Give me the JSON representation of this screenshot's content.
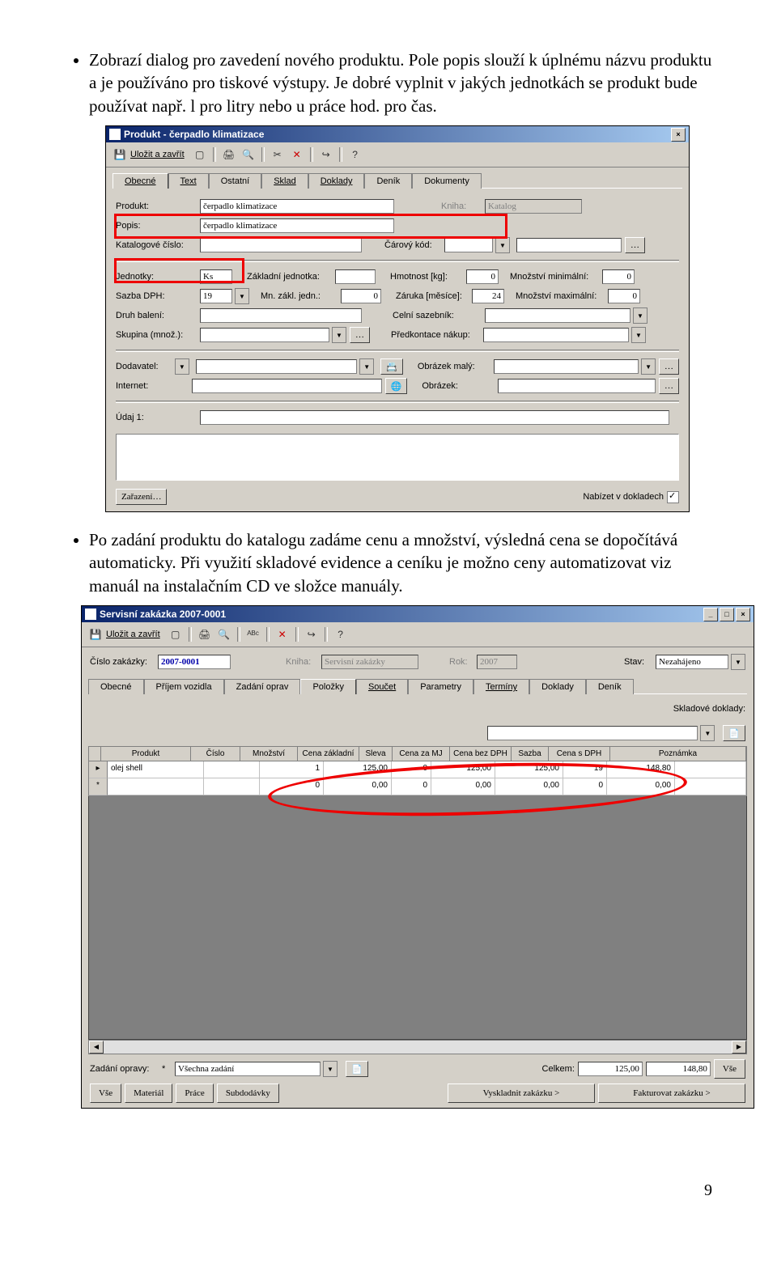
{
  "page_number": "9",
  "bullets": {
    "b1": "Zobrazí dialog pro zavedení nového produktu. Pole popis slouží k úplnému názvu produktu a je používáno pro tiskové výstupy. Je dobré vyplnit v jakých jednotkách se produkt bude používat např. l pro litry nebo u práce hod. pro čas.",
    "b2": "Po zadání produktu do katalogu zadáme cenu a množství, výsledná cena se dopočítává automaticky. Při využití skladové evidence a ceníku je možno ceny automatizovat viz manuál na instalačním CD ve složce manuály."
  },
  "win1": {
    "title": "Produkt - čerpadlo klimatizace",
    "save_close": "Uložit a zavřít",
    "tabs": {
      "obecne": "Obecné",
      "text": "Text",
      "ostatni": "Ostatní",
      "sklad": "Sklad",
      "doklady": "Doklady",
      "denik": "Deník",
      "dokumenty": "Dokumenty"
    },
    "labels": {
      "produkt": "Produkt:",
      "kniha": "Kniha:",
      "kniha_val": "Katalog",
      "popis": "Popis:",
      "katcislo": "Katalogové číslo:",
      "carkod": "Čárový kód:",
      "jednotky": "Jednotky:",
      "zakljedn": "Základní jednotka:",
      "hmotnost": "Hmotnost [kg]:",
      "mnozmin": "Množství minimální:",
      "sazbadph": "Sazba DPH:",
      "mnzakl": "Mn. zákl. jedn.:",
      "zaruka": "Záruka [měsíce]:",
      "mnozmax": "Množství maximální:",
      "druhbal": "Druh balení:",
      "celni": "Celní sazebník:",
      "skupina": "Skupina (množ.):",
      "predkont": "Předkontace nákup:",
      "dodavatel": "Dodavatel:",
      "obrmaly": "Obrázek malý:",
      "internet": "Internet:",
      "obrazek": "Obrázek:",
      "udaj1": "Údaj 1:",
      "zarazeni": "Zařazení…",
      "nabizet": "Nabízet v dokladech"
    },
    "values": {
      "produkt": "čerpadlo klimatizace",
      "popis": "čerpadlo klimatizace",
      "jednotky": "Ks",
      "sazbadph": "19",
      "mnzakl": "0",
      "hmotnost": "0",
      "zaruka": "24",
      "mnozmin": "0",
      "mnozmax": "0"
    }
  },
  "win2": {
    "title": "Servisní zakázka 2007-0001",
    "save_close": "Uložit a zavřít",
    "header": {
      "cislo_lbl": "Číslo zakázky:",
      "cislo": "2007-0001",
      "kniha_lbl": "Kniha:",
      "kniha": "Servisní zakázky",
      "rok_lbl": "Rok:",
      "rok": "2007",
      "stav_lbl": "Stav:",
      "stav": "Nezahájeno"
    },
    "tabs": {
      "obecne": "Obecné",
      "prijem": "Příjem vozidla",
      "zadani": "Zadání oprav",
      "polozky": "Položky",
      "soucet": "Součet",
      "parametry": "Parametry",
      "terminy": "Termíny",
      "doklady": "Doklady",
      "denik": "Deník"
    },
    "sklad_lbl": "Skladové doklady:",
    "cols": {
      "produkt": "Produkt",
      "cislo": "Číslo",
      "mnozstvi": "Množství",
      "cenazakl": "Cena základní",
      "sleva": "Sleva",
      "cenamj": "Cena za MJ",
      "cenabez": "Cena bez DPH",
      "sazba": "Sazba",
      "cenasdph": "Cena s DPH",
      "poznamka": "Poznámka"
    },
    "row1": {
      "produkt": "olej shell",
      "mnozstvi": "1",
      "cenazakl": "125,00",
      "sleva": "0",
      "cenamj": "125,00",
      "cenabez": "125,00",
      "sazba": "19",
      "cenasdph": "148,80"
    },
    "row2": {
      "mnozstvi": "0",
      "cenazakl": "0,00",
      "sleva": "0",
      "cenamj": "0,00",
      "cenabez": "0,00",
      "sazba": "0",
      "cenasdph": "0,00"
    },
    "footer": {
      "zadani_lbl": "Zadání opravy:",
      "zadani_val": "Všechna zadání",
      "celkem_lbl": "Celkem:",
      "c1": "125,00",
      "c2": "148,80",
      "vse": "Vše",
      "b_vse": "Vše",
      "b_mat": "Materiál",
      "b_prace": "Práce",
      "b_sub": "Subdodávky",
      "b_vysklad": "Vyskladnit zakázku >",
      "b_fakt": "Fakturovat zakázku >"
    }
  }
}
